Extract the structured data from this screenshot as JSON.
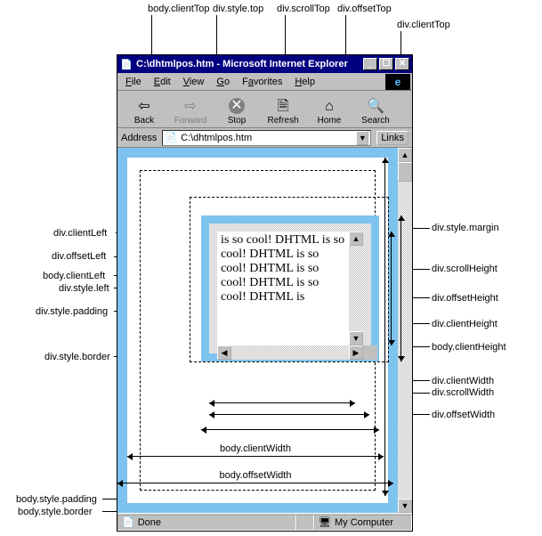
{
  "window": {
    "title": "C:\\dhtmlpos.htm - Microsoft Internet Explorer",
    "min": "_",
    "max": "☐",
    "close": "✕"
  },
  "menu": {
    "file": "File",
    "edit": "Edit",
    "view": "View",
    "go": "Go",
    "favorites": "Favorites",
    "help": "Help"
  },
  "toolbar": {
    "back": "Back",
    "forward": "Forward",
    "stop": "Stop",
    "refresh": "Refresh",
    "home": "Home",
    "search": "Search"
  },
  "address": {
    "label": "Address",
    "value": "C:\\dhtmlpos.htm",
    "links": "Links"
  },
  "status": {
    "done": "Done",
    "zone": "My Computer"
  },
  "content": {
    "text": "is so cool!\nDHTML is so cool! DHTML is so cool! DHTML is so cool!\nDHTML is so cool! DHTML is"
  },
  "labels": {
    "top_body_clientTop": "body.clientTop",
    "top_div_style_top": "div.style.top",
    "top_div_scrollTop": "div.scrollTop",
    "top_div_offsetTop": "div.offsetTop",
    "top_div_clientTop": "div.clientTop",
    "left_div_clientLeft": "div.clientLeft",
    "left_div_offsetLeft": "div.offsetLeft",
    "left_body_clientLeft": "body.clientLeft",
    "left_div_style_left": "div.style.left",
    "left_div_style_padding": "div.style.padding",
    "left_div_style_border": "div.style.border",
    "right_div_style_margin": "div.style.margin",
    "right_div_scrollHeight": "div.scrollHeight",
    "right_div_offsetHeight": "div.offsetHeight",
    "right_div_clientHeight": "div.clientHeight",
    "right_body_clientHeight": "body.clientHeight",
    "right_div_clientWidth": "div.clientWidth",
    "right_div_scrollWidth": "div.scrollWidth",
    "right_div_offsetWidth": "div.offsetWidth",
    "bottom_body_clientWidth": "body.clientWidth",
    "bottom_body_offsetWidth": "body.offsetWidth",
    "bl_body_style_padding": "body.style.padding",
    "bl_body_style_border": "body.style.border"
  }
}
